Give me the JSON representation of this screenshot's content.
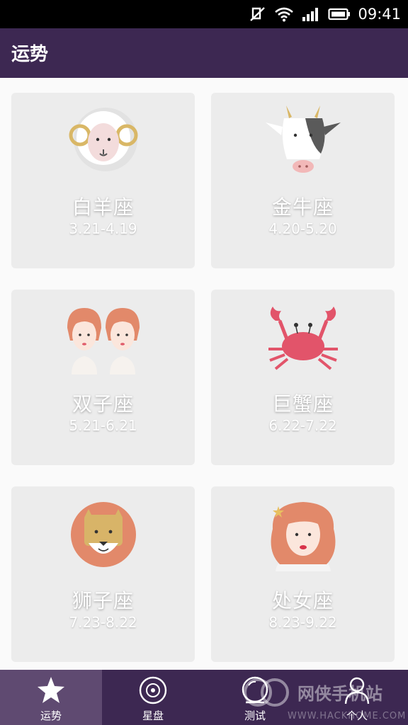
{
  "status_bar": {
    "time": "09:41"
  },
  "header": {
    "title": "运势"
  },
  "signs": [
    {
      "name": "白羊座",
      "dates": "3.21-4.19",
      "icon": "aries-ram-icon"
    },
    {
      "name": "金牛座",
      "dates": "4.20-5.20",
      "icon": "taurus-bull-icon"
    },
    {
      "name": "双子座",
      "dates": "5.21-6.21",
      "icon": "gemini-twins-icon"
    },
    {
      "name": "巨蟹座",
      "dates": "6.22-7.22",
      "icon": "cancer-crab-icon"
    },
    {
      "name": "狮子座",
      "dates": "7.23-8.22",
      "icon": "leo-lion-icon"
    },
    {
      "name": "处女座",
      "dates": "8.23-9.22",
      "icon": "virgo-maiden-icon"
    }
  ],
  "bottom_nav": [
    {
      "label": "运势",
      "icon": "star-icon",
      "active": true
    },
    {
      "label": "星盘",
      "icon": "chart-disc-icon",
      "active": false
    },
    {
      "label": "测试",
      "icon": "test-icon",
      "active": false
    },
    {
      "label": "个人",
      "icon": "person-icon",
      "active": false
    }
  ],
  "watermark": {
    "text": "网侠手机站",
    "url": "WWW.HACKHOME.COM"
  },
  "colors": {
    "header": "#3d2852",
    "nav_active": "#5f4a71",
    "card": "#ececec"
  }
}
